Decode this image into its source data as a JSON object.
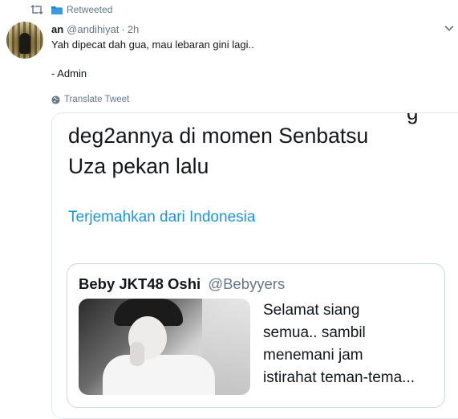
{
  "retweet": {
    "label": "Retweeted"
  },
  "tweet": {
    "name": "an",
    "handle": "@andihiyat",
    "separator": "·",
    "time": "2h",
    "text_line1": "Yah dipecat dah gua, mau lebaran gini lagi..",
    "text_line2": "",
    "text_line3": "- Admin",
    "translate": "Translate Tweet"
  },
  "card": {
    "partial_line": "g",
    "big_text": "deg2annya di momen Senbatsu\nUza pekan lalu",
    "translate_link": "Terjemahkan dari Indonesia",
    "quote": {
      "name": "Beby JKT48 Oshi",
      "handle": "@Bebyyers",
      "text": "Selamat siang\nsemua.. sambil\nmenemani jam\nistirahat teman-tema..."
    }
  },
  "colors": {
    "link": "#1b95e0",
    "muted": "#657786",
    "border": "#e1e8ed"
  }
}
